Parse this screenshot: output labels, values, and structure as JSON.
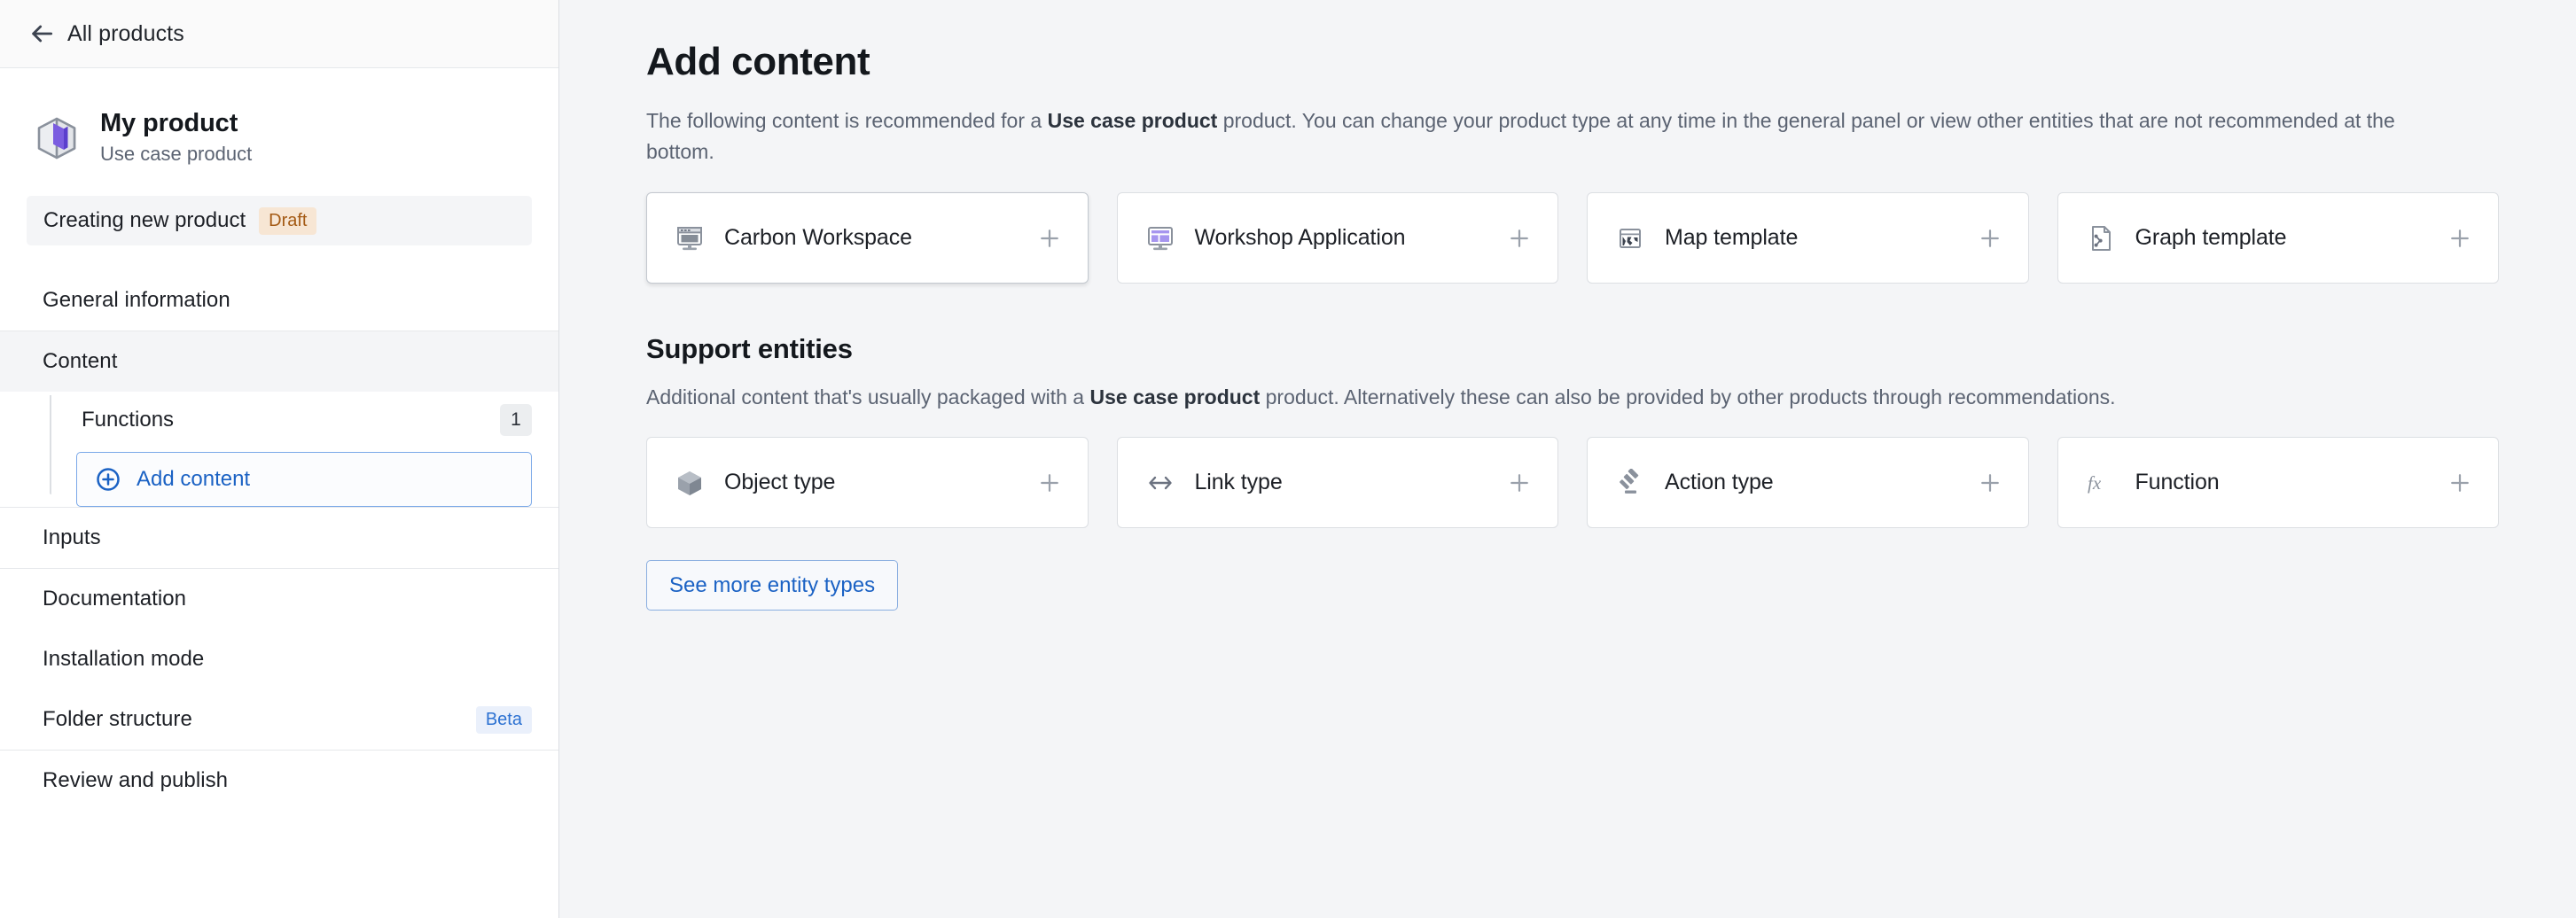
{
  "sidebar": {
    "back_label": "All products",
    "back_icon": "arrow-left-icon",
    "product": {
      "icon": "cube-box-icon",
      "name": "My product",
      "type": "Use case product"
    },
    "draft_row": {
      "label": "Creating new product",
      "badge": "Draft",
      "badge_color": "#a45a14",
      "badge_bg": "#f7e6d4"
    },
    "nav_items": [
      {
        "label": "General information",
        "active": false,
        "badge": null
      },
      {
        "label": "Content",
        "active": true,
        "badge": null
      },
      {
        "label": "Inputs",
        "active": false,
        "badge": null
      },
      {
        "label": "Documentation",
        "active": false,
        "badge": null
      },
      {
        "label": "Installation mode",
        "active": false,
        "badge": null
      },
      {
        "label": "Folder structure",
        "active": false,
        "badge": "Beta"
      },
      {
        "label": "Review and publish",
        "active": false,
        "badge": null
      }
    ],
    "sub_items": [
      {
        "label": "Functions",
        "count": "1"
      }
    ],
    "add_content": {
      "label": "Add content",
      "icon": "plus-circle-icon",
      "color": "#1b62c4"
    }
  },
  "main": {
    "title": "Add content",
    "description_pre": "The following content is recommended for a ",
    "description_bold": "Use case product",
    "description_post": " product. You can change your product type at any time in the general panel or view other entities that are not recommended at the bottom.",
    "recommended_cards": [
      {
        "label": "Carbon Workspace",
        "icon": "workspace-monitor-icon",
        "hovered": true
      },
      {
        "label": "Workshop Application",
        "icon": "workshop-dashboard-icon",
        "hovered": false
      },
      {
        "label": "Map template",
        "icon": "map-window-icon",
        "hovered": false
      },
      {
        "label": "Graph template",
        "icon": "graph-document-icon",
        "hovered": false
      }
    ],
    "support_section": {
      "title": "Support entities",
      "description_pre": "Additional content that's usually packaged with a ",
      "description_bold": "Use case product",
      "description_post": " product. Alternatively these can also be provided by other products through recommendations."
    },
    "support_cards": [
      {
        "label": "Object type",
        "icon": "cube-icon",
        "hovered": false
      },
      {
        "label": "Link type",
        "icon": "arrows-horizontal-icon",
        "hovered": false
      },
      {
        "label": "Action type",
        "icon": "gavel-icon",
        "hovered": false
      },
      {
        "label": "Function",
        "icon": "fx-icon",
        "hovered": false
      }
    ],
    "see_more_label": "See more entity types",
    "plus_icon": "plus-icon"
  }
}
